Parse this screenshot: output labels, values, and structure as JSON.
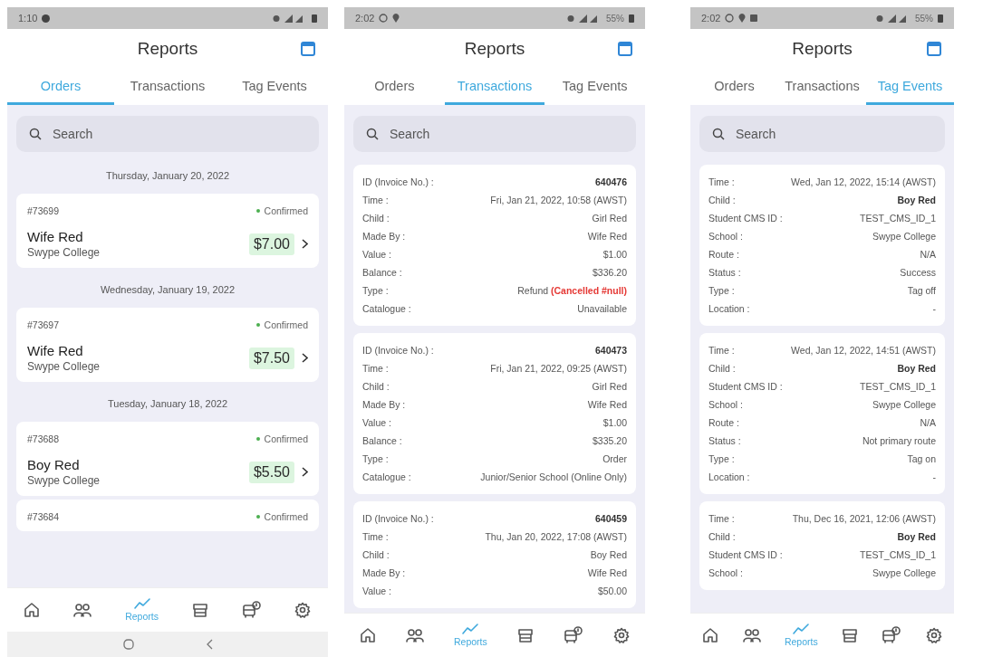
{
  "phones": [
    {
      "kind": "orders",
      "status_bar": {
        "time": "1:10"
      },
      "title": "Reports",
      "tabs": [
        {
          "label": "Orders",
          "selected": true
        },
        {
          "label": "Transactions",
          "selected": false
        },
        {
          "label": "Tag Events",
          "selected": false
        }
      ],
      "search": {
        "placeholder": "Search"
      },
      "groups": [
        {
          "date": "Thursday, January 20, 2022",
          "orders": [
            {
              "id": "#73699",
              "status": "Confirmed",
              "name": "Wife Red",
              "school": "Swype College",
              "amount": "$7.00"
            }
          ]
        },
        {
          "date": "Wednesday, January 19, 2022",
          "orders": [
            {
              "id": "#73697",
              "status": "Confirmed",
              "name": "Wife Red",
              "school": "Swype College",
              "amount": "$7.50"
            }
          ]
        },
        {
          "date": "Tuesday, January 18, 2022",
          "orders": [
            {
              "id": "#73688",
              "status": "Confirmed",
              "name": "Boy Red",
              "school": "Swype College",
              "amount": "$5.50"
            },
            {
              "id": "#73684",
              "status": "Confirmed"
            }
          ]
        }
      ],
      "nav": [
        {
          "selected": false
        },
        {
          "selected": false
        },
        {
          "label": "Reports",
          "selected": true
        },
        {
          "selected": false
        },
        {
          "selected": false
        },
        {
          "selected": false
        }
      ],
      "system_nav": true
    },
    {
      "kind": "details",
      "status_bar": {
        "time": "2:02",
        "battery": "55%"
      },
      "title": "Reports",
      "tabs": [
        {
          "label": "Orders",
          "selected": false
        },
        {
          "label": "Transactions",
          "selected": true
        },
        {
          "label": "Tag Events",
          "selected": false
        }
      ],
      "search": {
        "placeholder": "Search"
      },
      "cards": [
        {
          "rows": [
            {
              "label": "ID (Invoice No.) :",
              "value": "640476",
              "bold": true
            },
            {
              "label": "Time :",
              "value": "Fri, Jan 21, 2022, 10:58 (AWST)"
            },
            {
              "label": "Child :",
              "value": "Girl Red"
            },
            {
              "label": "Made By :",
              "value": "Wife Red"
            },
            {
              "label": "Value :",
              "value": "$1.00"
            },
            {
              "label": "Balance :",
              "value": "$336.20"
            },
            {
              "label": "Type :",
              "value": "Refund",
              "note": "(Cancelled #null)"
            },
            {
              "label": "Catalogue :",
              "value": "Unavailable"
            }
          ]
        },
        {
          "rows": [
            {
              "label": "ID (Invoice No.) :",
              "value": "640473",
              "bold": true
            },
            {
              "label": "Time :",
              "value": "Fri, Jan 21, 2022, 09:25 (AWST)"
            },
            {
              "label": "Child :",
              "value": "Girl Red"
            },
            {
              "label": "Made By :",
              "value": "Wife Red"
            },
            {
              "label": "Value :",
              "value": "$1.00"
            },
            {
              "label": "Balance :",
              "value": "$335.20"
            },
            {
              "label": "Type :",
              "value": "Order"
            },
            {
              "label": "Catalogue :",
              "value": "Junior/Senior School (Online Only)"
            }
          ]
        },
        {
          "rows": [
            {
              "label": "ID (Invoice No.) :",
              "value": "640459",
              "bold": true
            },
            {
              "label": "Time :",
              "value": "Thu, Jan 20, 2022, 17:08 (AWST)"
            },
            {
              "label": "Child :",
              "value": "Boy Red"
            },
            {
              "label": "Made By :",
              "value": "Wife Red"
            },
            {
              "label": "Value :",
              "value": "$50.00"
            }
          ]
        }
      ],
      "nav": [
        {
          "selected": false
        },
        {
          "selected": false
        },
        {
          "label": "Reports",
          "selected": true
        },
        {
          "selected": false
        },
        {
          "selected": false
        },
        {
          "selected": false
        }
      ]
    },
    {
      "kind": "details",
      "status_bar": {
        "time": "2:02",
        "battery": "55%"
      },
      "title": "Reports",
      "tabs": [
        {
          "label": "Orders",
          "selected": false
        },
        {
          "label": "Transactions",
          "selected": false
        },
        {
          "label": "Tag Events",
          "selected": true
        }
      ],
      "search": {
        "placeholder": "Search"
      },
      "cards": [
        {
          "rows": [
            {
              "label": "Time :",
              "value": "Wed, Jan 12, 2022, 15:14 (AWST)"
            },
            {
              "label": "Child :",
              "value": "Boy Red",
              "bold": true
            },
            {
              "label": "Student CMS ID :",
              "value": "TEST_CMS_ID_1"
            },
            {
              "label": "School :",
              "value": "Swype College"
            },
            {
              "label": "Route :",
              "value": "N/A"
            },
            {
              "label": "Status :",
              "value": "Success"
            },
            {
              "label": "Type :",
              "value": "Tag off"
            },
            {
              "label": "Location :",
              "value": "-"
            }
          ]
        },
        {
          "rows": [
            {
              "label": "Time :",
              "value": "Wed, Jan 12, 2022, 14:51 (AWST)"
            },
            {
              "label": "Child :",
              "value": "Boy Red",
              "bold": true
            },
            {
              "label": "Student CMS ID :",
              "value": "TEST_CMS_ID_1"
            },
            {
              "label": "School :",
              "value": "Swype College"
            },
            {
              "label": "Route :",
              "value": "N/A"
            },
            {
              "label": "Status :",
              "value": "Not primary route"
            },
            {
              "label": "Type :",
              "value": "Tag on"
            },
            {
              "label": "Location :",
              "value": "-"
            }
          ]
        },
        {
          "rows": [
            {
              "label": "Time :",
              "value": "Thu, Dec 16, 2021, 12:06 (AWST)"
            },
            {
              "label": "Child :",
              "value": "Boy Red",
              "bold": true
            },
            {
              "label": "Student CMS ID :",
              "value": "TEST_CMS_ID_1"
            },
            {
              "label": "School :",
              "value": "Swype College"
            }
          ]
        }
      ],
      "nav": [
        {
          "selected": false
        },
        {
          "selected": false
        },
        {
          "label": "Reports",
          "selected": true
        },
        {
          "selected": false
        },
        {
          "selected": false
        },
        {
          "selected": false
        }
      ]
    }
  ]
}
